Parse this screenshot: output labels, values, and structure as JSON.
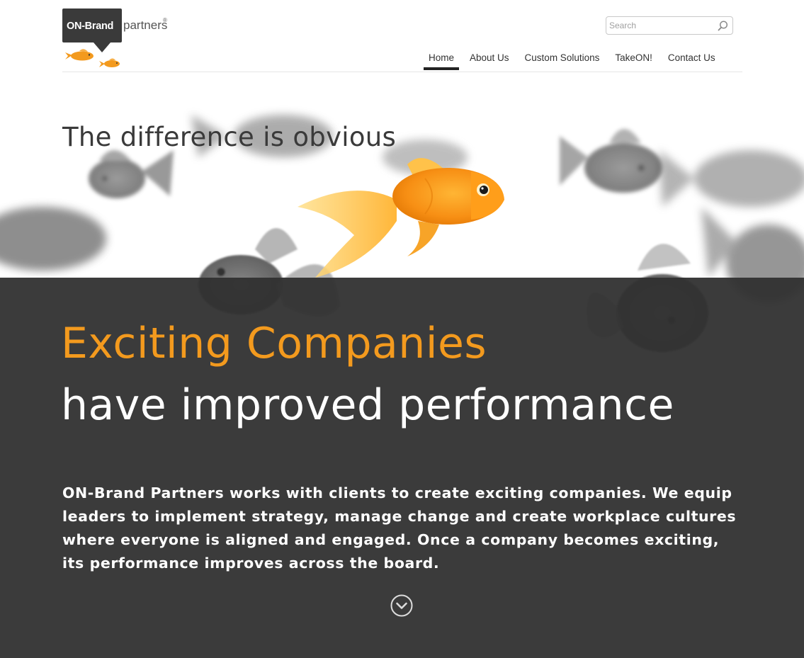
{
  "header": {
    "logo": {
      "brand_text": "ON-Brand",
      "partners_text": "partners",
      "registered_mark": "®",
      "colors": {
        "box": "#3a3a3a",
        "fish": "#f39a1e"
      }
    },
    "search": {
      "placeholder": "Search",
      "value": "",
      "icon": "search-icon"
    },
    "nav": {
      "active_index": 0,
      "items": [
        {
          "label": "Home"
        },
        {
          "label": "About Us"
        },
        {
          "label": "Custom Solutions"
        },
        {
          "label": "TakeON!"
        },
        {
          "label": "Contact Us"
        }
      ]
    }
  },
  "hero": {
    "tagline": "The difference is obvious",
    "headline_highlight": "Exciting Companies",
    "headline_rest": "have improved performance",
    "intro": "ON-Brand Partners works with clients to create exciting companies. We equip leaders to implement strategy, manage change and create workplace cultures where everyone is aligned and engaged. Once a company becomes exciting, its performance improves across the board.",
    "scroll_icon": "chevron-down-circle-icon",
    "colors": {
      "accent": "#f39a1e",
      "overlay": "#303030",
      "headline": "#ffffff"
    }
  }
}
